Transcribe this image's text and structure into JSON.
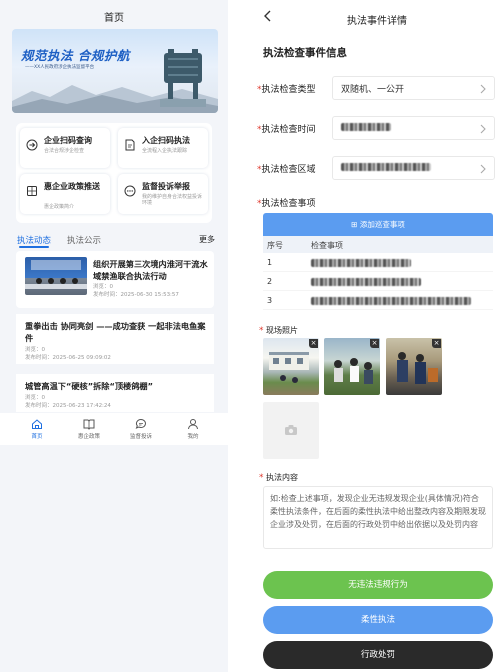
{
  "home": {
    "title": "首页",
    "banner": {
      "title": "规范执法 合规护航",
      "subtitle": "——XX人民政府涉企执法监督平台"
    },
    "entries": [
      {
        "title": "企业扫码查询",
        "subtitle": "合法合规涉企检查"
      },
      {
        "title": "入企扫码执法",
        "subtitle": "全流程入企执法跟踪"
      },
      {
        "title": "惠企业政策推送",
        "subtitle": "惠企政策简介"
      },
      {
        "title": "监督投诉举报",
        "subtitle": "我的维护自身合法权益投诉环境"
      }
    ],
    "tabs": {
      "active": "执法动态",
      "second": "执法公示",
      "more": "更多"
    },
    "news": [
      {
        "title": "组织开展第三次境内淮河干流水域禁渔联合执法行动",
        "views": "浏览：0",
        "time": "发布时间：2025-06-30 15:53:57"
      },
      {
        "title": "重拳出击 协同亮剑 ——成功查获 一起非法电鱼案件",
        "views": "浏览：0",
        "time": "发布时间：2025-06-25 09:09:02"
      },
      {
        "title": "城管高温下“硬核”拆除“顶楼鸽棚”",
        "views": "浏览：0",
        "time": "发布时间：2025-06-23 17:42:24"
      }
    ],
    "nav": [
      {
        "label": "首页",
        "icon": "home-icon"
      },
      {
        "label": "惠企政策",
        "icon": "book-icon"
      },
      {
        "label": "监督投诉",
        "icon": "chat-icon"
      },
      {
        "label": "我的",
        "icon": "user-icon"
      }
    ]
  },
  "detail": {
    "title": "执法事件详情",
    "section": "执法检查事件信息",
    "fields": {
      "type": {
        "label": "执法检查类型",
        "value": "双随机、一公开"
      },
      "time": {
        "label": "执法检查时间"
      },
      "area": {
        "label": "执法检查区域"
      }
    },
    "items_label": "执法检查事项",
    "add_button": "添加巡查事项",
    "table": {
      "headers": [
        "序号",
        "检查事项"
      ],
      "rows": [
        "1",
        "2",
        "3"
      ]
    },
    "photos_label": "现场照片",
    "content_label": "执法内容",
    "content_placeholder": "如:检查上述事项，发现企业无违规发现企业(具体情况)符合柔性执法条件，在后面的柔性执法中给出整改内容及期限发现企业涉及处罚，在后面的行政处罚中给出依据以及处罚内容",
    "buttons": {
      "no_violation": "无违法违规行为",
      "soft": "柔性执法",
      "penalty": "行政处罚"
    }
  },
  "colors": {
    "accent": "#1e6fe0",
    "green": "#6cc34f",
    "blue": "#5b9cf0",
    "dark": "#2a2a2a",
    "required": "#e03a2f"
  }
}
